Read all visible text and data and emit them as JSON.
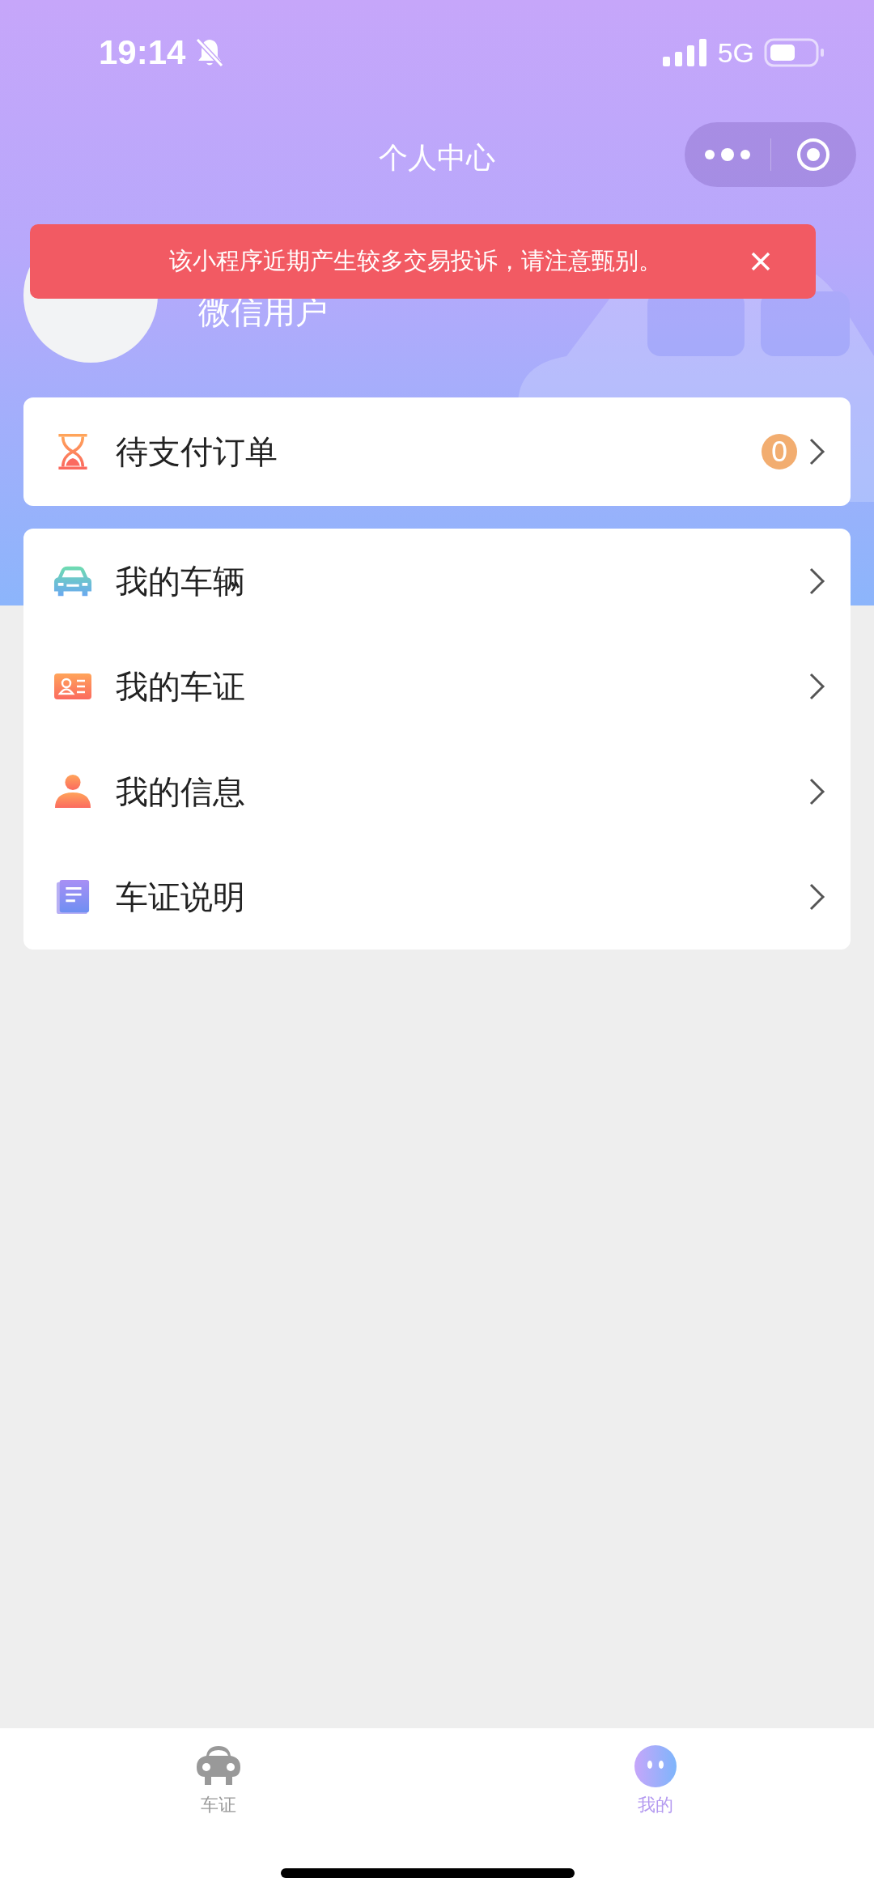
{
  "status_bar": {
    "time": "19:14",
    "network": "5G"
  },
  "nav": {
    "title": "个人中心"
  },
  "toast": {
    "message": "该小程序近期产生较多交易投诉，请注意甄别。"
  },
  "profile": {
    "name": "微信用户"
  },
  "order_card": {
    "label": "待支付订单",
    "count": "0"
  },
  "menu": [
    {
      "label": "我的车辆",
      "kind": "car"
    },
    {
      "label": "我的车证",
      "kind": "card"
    },
    {
      "label": "我的信息",
      "kind": "person"
    },
    {
      "label": "车证说明",
      "kind": "book"
    }
  ],
  "tab_bar": [
    {
      "label": "车证",
      "kind": "car",
      "selected": false
    },
    {
      "label": "我的",
      "kind": "face",
      "selected": true
    }
  ]
}
